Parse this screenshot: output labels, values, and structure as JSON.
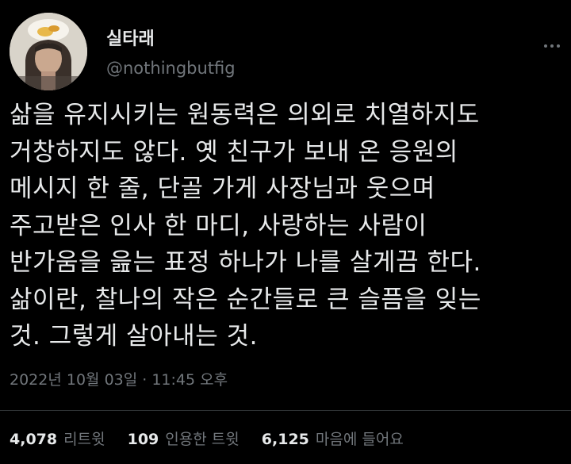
{
  "user": {
    "display_name": "실타래",
    "handle": "@nothingbutfig"
  },
  "tweet": {
    "lines": [
      "삶을 유지시키는 원동력은 의외로 치열하지도",
      "거창하지도 않다. 옛 친구가 보내 온 응원의",
      "메시지 한 줄, 단골 가게 사장님과 웃으며",
      "주고받은 인사 한 마디, 사랑하는 사람이",
      "반가움을 읊는 표정 하나가 나를 살게끔 한다.",
      "삶이란, 찰나의 작은 순간들로 큰 슬픔을 잊는",
      "것. 그렇게 살아내는 것."
    ],
    "timestamp": "2022년 10월 03일 · 11:45 오후"
  },
  "stats": {
    "retweets_count": "4,078",
    "retweets_label": "리트윗",
    "quotes_count": "109",
    "quotes_label": "인용한 트윗",
    "likes_count": "6,125",
    "likes_label": "마음에 들어요"
  },
  "icons": {
    "more": "more-dots-icon",
    "avatar": "avatar-photo"
  },
  "colors": {
    "background": "#000000",
    "text": "#e7e9ea",
    "secondary": "#71767b",
    "divider": "#2f3336"
  }
}
